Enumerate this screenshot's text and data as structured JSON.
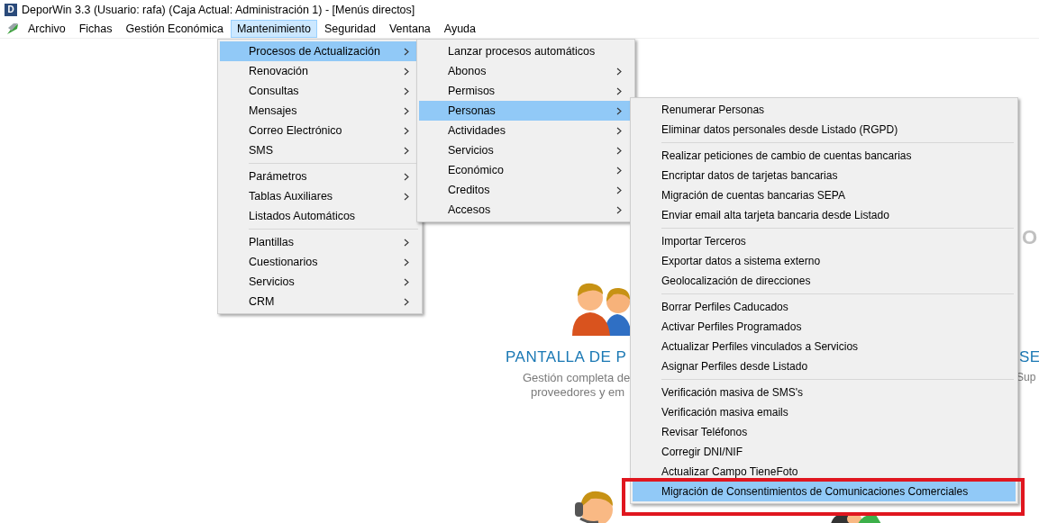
{
  "window": {
    "icon_letter": "D",
    "title": "DeporWin 3.3  (Usuario: rafa)  (Caja Actual: Administración 1) - [Menús directos]"
  },
  "menu_bar": [
    {
      "label": "Archivo",
      "selected": false
    },
    {
      "label": "Fichas",
      "selected": false
    },
    {
      "label": "Gestión Económica",
      "selected": false
    },
    {
      "label": "Mantenimiento",
      "selected": true
    },
    {
      "label": "Seguridad",
      "selected": false
    },
    {
      "label": "Ventana",
      "selected": false
    },
    {
      "label": "Ayuda",
      "selected": false
    }
  ],
  "background": {
    "heading_fragment_right": "O",
    "card_title": "PANTALLA DE P",
    "card_text_lines": [
      "Gestión completa de",
      "proveedores y em"
    ],
    "card_title_right": "SE",
    "card_text_right": "Sup"
  },
  "menus": [
    {
      "items": [
        {
          "kind": "item",
          "label": "Procesos de Actualización",
          "submenu": true,
          "selected": true
        },
        {
          "kind": "item",
          "label": "Renovación",
          "submenu": true,
          "selected": false
        },
        {
          "kind": "item",
          "label": "Consultas",
          "submenu": true,
          "selected": false
        },
        {
          "kind": "item",
          "label": "Mensajes",
          "submenu": true,
          "selected": false
        },
        {
          "kind": "item",
          "label": "Correo Electrónico",
          "submenu": true,
          "selected": false
        },
        {
          "kind": "item",
          "label": "SMS",
          "submenu": true,
          "selected": false
        },
        {
          "kind": "separator"
        },
        {
          "kind": "item",
          "label": "Parámetros",
          "submenu": true,
          "selected": false
        },
        {
          "kind": "item",
          "label": "Tablas Auxiliares",
          "submenu": true,
          "selected": false
        },
        {
          "kind": "item",
          "label": "Listados Automáticos",
          "submenu": false,
          "selected": false
        },
        {
          "kind": "separator"
        },
        {
          "kind": "item",
          "label": "Plantillas",
          "submenu": true,
          "selected": false
        },
        {
          "kind": "item",
          "label": "Cuestionarios",
          "submenu": true,
          "selected": false
        },
        {
          "kind": "item",
          "label": "Servicios",
          "submenu": true,
          "selected": false
        },
        {
          "kind": "item",
          "label": "CRM",
          "submenu": true,
          "selected": false
        }
      ]
    },
    {
      "items": [
        {
          "kind": "item",
          "label": "Lanzar procesos automáticos",
          "submenu": false,
          "selected": false
        },
        {
          "kind": "item",
          "label": "Abonos",
          "submenu": true,
          "selected": false
        },
        {
          "kind": "item",
          "label": "Permisos",
          "submenu": true,
          "selected": false
        },
        {
          "kind": "item",
          "label": "Personas",
          "submenu": true,
          "selected": true
        },
        {
          "kind": "item",
          "label": "Actividades",
          "submenu": true,
          "selected": false
        },
        {
          "kind": "item",
          "label": "Servicios",
          "submenu": true,
          "selected": false
        },
        {
          "kind": "item",
          "label": "Económico",
          "submenu": true,
          "selected": false
        },
        {
          "kind": "item",
          "label": "Creditos",
          "submenu": true,
          "selected": false
        },
        {
          "kind": "item",
          "label": "Accesos",
          "submenu": true,
          "selected": false
        }
      ]
    },
    {
      "items": [
        {
          "kind": "item",
          "label": "Renumerar Personas",
          "submenu": false,
          "selected": false
        },
        {
          "kind": "item",
          "label": "Eliminar datos personales desde Listado (RGPD)",
          "submenu": false,
          "selected": false
        },
        {
          "kind": "separator"
        },
        {
          "kind": "item",
          "label": "Realizar peticiones de cambio de cuentas bancarias",
          "submenu": false,
          "selected": false
        },
        {
          "kind": "item",
          "label": "Encriptar datos de tarjetas bancarias",
          "submenu": false,
          "selected": false
        },
        {
          "kind": "item",
          "label": "Migración de cuentas bancarias SEPA",
          "submenu": false,
          "selected": false
        },
        {
          "kind": "item",
          "label": "Enviar email alta tarjeta bancaria desde Listado",
          "submenu": false,
          "selected": false
        },
        {
          "kind": "separator"
        },
        {
          "kind": "item",
          "label": "Importar Terceros",
          "submenu": false,
          "selected": false
        },
        {
          "kind": "item",
          "label": "Exportar datos a sistema externo",
          "submenu": false,
          "selected": false
        },
        {
          "kind": "item",
          "label": "Geolocalización de direcciones",
          "submenu": false,
          "selected": false
        },
        {
          "kind": "separator"
        },
        {
          "kind": "item",
          "label": "Borrar Perfiles Caducados",
          "submenu": false,
          "selected": false
        },
        {
          "kind": "item",
          "label": "Activar Perfiles Programados",
          "submenu": false,
          "selected": false
        },
        {
          "kind": "item",
          "label": "Actualizar Perfiles vinculados a Servicios",
          "submenu": false,
          "selected": false
        },
        {
          "kind": "item",
          "label": "Asignar Perfiles desde Listado",
          "submenu": false,
          "selected": false
        },
        {
          "kind": "separator"
        },
        {
          "kind": "item",
          "label": "Verificación masiva de SMS's",
          "submenu": false,
          "selected": false
        },
        {
          "kind": "item",
          "label": "Verificación masiva emails",
          "submenu": false,
          "selected": false
        },
        {
          "kind": "item",
          "label": "Revisar Teléfonos",
          "submenu": false,
          "selected": false
        },
        {
          "kind": "item",
          "label": "Corregir DNI/NIF",
          "submenu": false,
          "selected": false
        },
        {
          "kind": "item",
          "label": "Actualizar Campo TieneFoto",
          "submenu": false,
          "selected": false
        },
        {
          "kind": "item",
          "label": "Migración de Consentimientos de Comunicaciones Comerciales",
          "submenu": false,
          "selected": true
        }
      ]
    }
  ],
  "annotation": {
    "kind": "frame"
  }
}
